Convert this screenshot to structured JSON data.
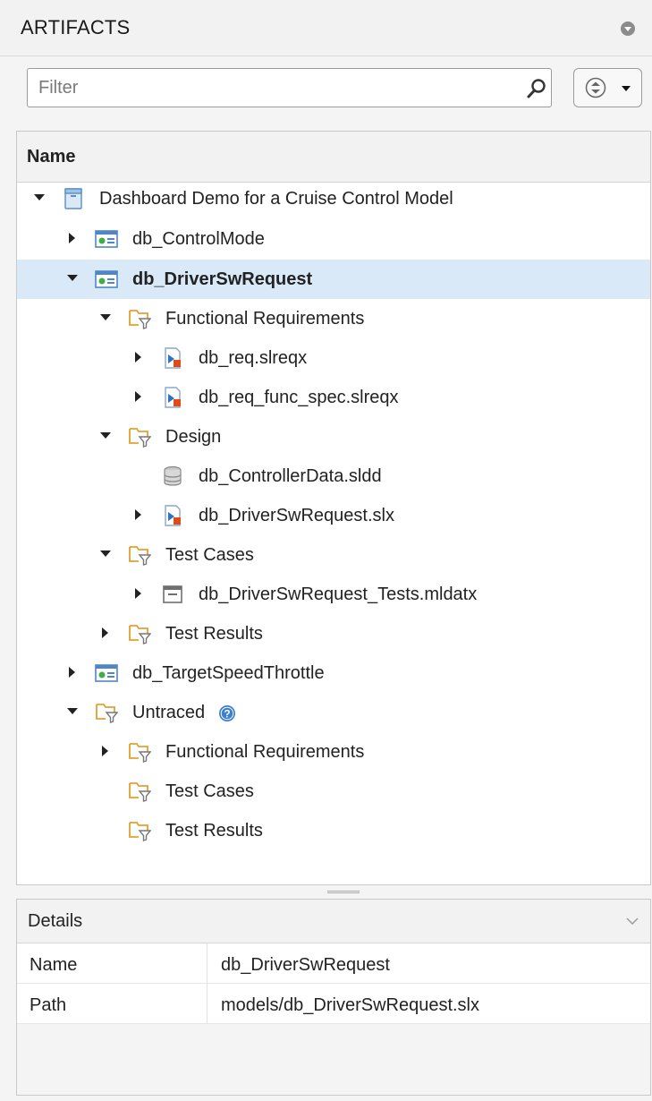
{
  "header": {
    "title": "ARTIFACTS",
    "menu_icon": "circle-chevron-down-icon"
  },
  "filter": {
    "placeholder": "Filter",
    "value": ""
  },
  "tree": {
    "column_header": "Name",
    "rows": [
      {
        "label": "Dashboard Demo for a Cruise Control Model",
        "expanded": true,
        "icon": "project-icon"
      },
      {
        "label": "db_ControlMode",
        "expanded": false,
        "icon": "model-unit-icon"
      },
      {
        "label": "db_DriverSwRequest",
        "expanded": true,
        "selected": true,
        "icon": "model-unit-icon"
      },
      {
        "label": "Functional Requirements",
        "expanded": true,
        "icon": "folder-filter-icon"
      },
      {
        "label": "db_req.slreqx",
        "expanded": false,
        "icon": "requirements-file-icon"
      },
      {
        "label": "db_req_func_spec.slreqx",
        "expanded": false,
        "icon": "requirements-file-icon"
      },
      {
        "label": "Design",
        "expanded": true,
        "icon": "folder-filter-icon"
      },
      {
        "label": "db_ControllerData.sldd",
        "icon": "data-dictionary-icon"
      },
      {
        "label": "db_DriverSwRequest.slx",
        "expanded": false,
        "icon": "simulink-model-icon"
      },
      {
        "label": "Test Cases",
        "expanded": true,
        "icon": "folder-filter-icon"
      },
      {
        "label": "db_DriverSwRequest_Tests.mldatx",
        "expanded": false,
        "icon": "test-file-icon"
      },
      {
        "label": "Test Results",
        "expanded": false,
        "icon": "folder-filter-icon"
      },
      {
        "label": "db_TargetSpeedThrottle",
        "expanded": false,
        "icon": "model-unit-icon"
      },
      {
        "label": "Untraced",
        "expanded": true,
        "icon": "folder-filter-icon",
        "help_icon": "question-circle-icon"
      },
      {
        "label": "Functional Requirements",
        "expanded": false,
        "icon": "folder-filter-icon"
      },
      {
        "label": "Test Cases",
        "icon": "folder-filter-icon"
      },
      {
        "label": "Test Results",
        "icon": "folder-filter-icon"
      }
    ]
  },
  "details": {
    "title": "Details",
    "rows": [
      {
        "key": "Name",
        "value": "db_DriverSwRequest"
      },
      {
        "key": "Path",
        "value": "models/db_DriverSwRequest.slx"
      }
    ]
  },
  "colors": {
    "selection": "#d9e9f7",
    "folder": "#e0a030",
    "link": "#1f6fc5"
  }
}
